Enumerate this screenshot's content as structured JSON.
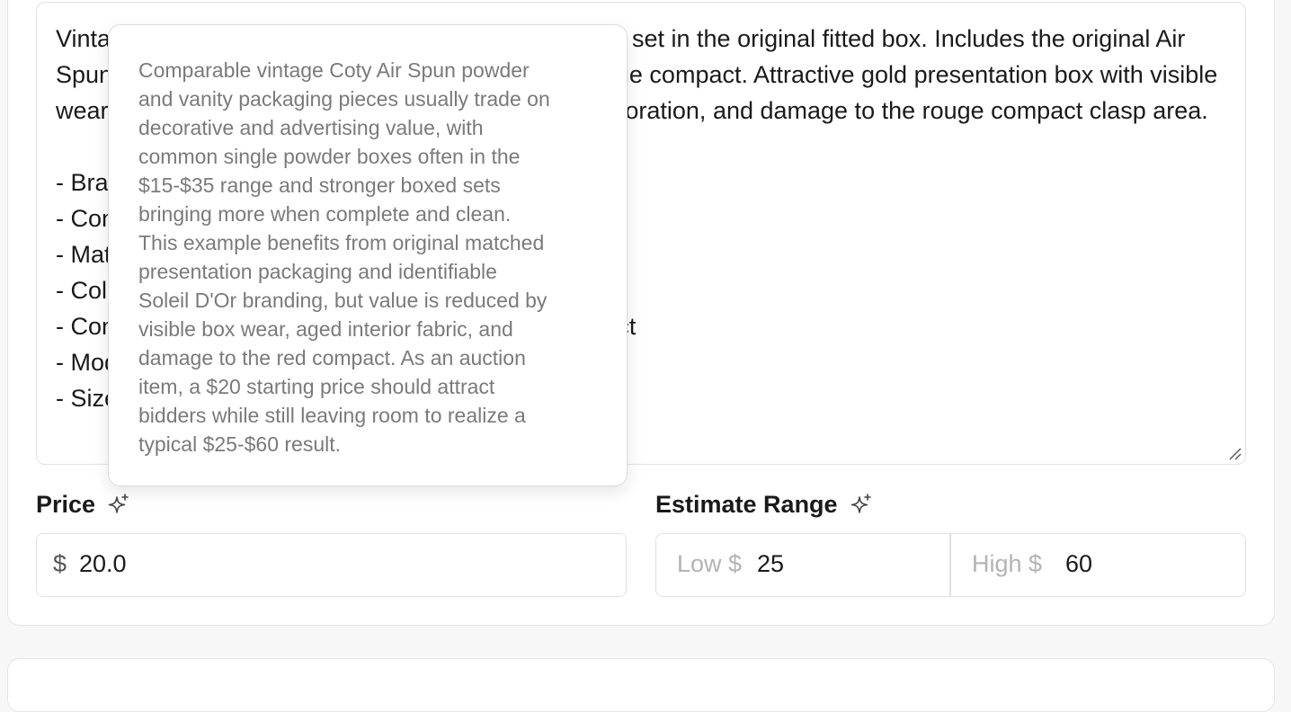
{
  "description": {
    "text": "Vintage Coty Air Spun Soleil D'Or presentation vanity set in the original fitted box. Includes the original Air Spun face powder box/container, and red plastic rouge compact. Attractive gold presentation box with visible wear from age, including edge wear, lining age discoloration, and damage to the rouge compact clasp area.\n\n- Brand: Coty\n- Condition: Used\n- Material: Cardboard, plastic\n- Color: Gold, red\n- Components: Box, powder container, rouge compact\n- Model: Air Spun Soleil D'Or\n- Size: Standard"
  },
  "tooltip": {
    "text": "Comparable vintage Coty Air Spun powder\nand vanity packaging pieces usually trade on\ndecorative and advertising value, with\ncommon single powder boxes often in the\n$15-$35 range and stronger boxed sets\nbringing more when complete and clean.\nThis example benefits from original matched\npresentation packaging and identifiable\nSoleil D'Or branding, but value is reduced by\nvisible box wear, aged interior fabric, and\ndamage to the red compact. As an auction\nitem, a $20 starting price should attract\nbidders while still leaving room to realize a\ntypical $25-$60 result."
  },
  "price": {
    "label": "Price",
    "currency_prefix": "$",
    "value": "20.0"
  },
  "estimate": {
    "label": "Estimate Range",
    "low_prefix": "Low $",
    "low_value": "25",
    "high_prefix": "High $",
    "high_value": "60"
  },
  "icons": {
    "price_ai": "sparkle-icon",
    "estimate_ai": "sparkle-icon"
  },
  "colors": {
    "border": "#e2e2e2",
    "muted_text": "#b3b3b3",
    "tooltip_text": "#7a7a7a"
  }
}
